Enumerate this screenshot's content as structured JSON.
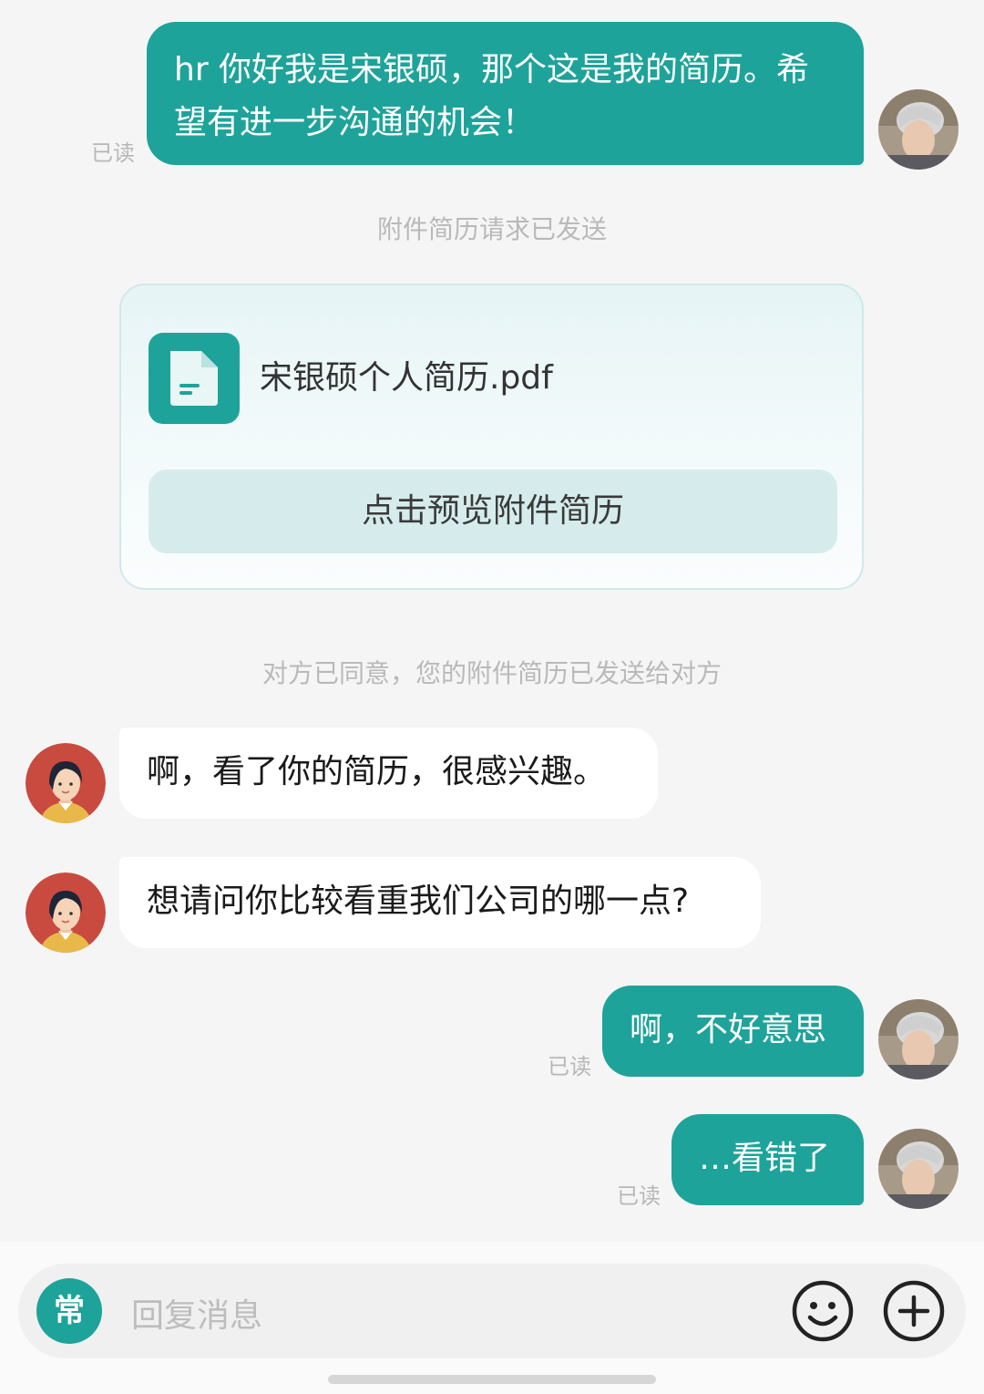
{
  "messages": {
    "m1": {
      "text": "hr 你好我是宋银硕，那个这是我的简历。希望有进一步沟通的机会！",
      "status": "已读"
    },
    "m4": {
      "text": "啊，不好意思",
      "status": "已读"
    },
    "m5": {
      "text": "…看错了",
      "status": "已读"
    },
    "hr1": {
      "text": "啊，看了你的简历，很感兴趣。"
    },
    "hr2": {
      "text": "想请问你比较看重我们公司的哪一点?"
    }
  },
  "system": {
    "request_sent": "附件简历请求已发送",
    "agreed": "对方已同意，您的附件简历已发送给对方"
  },
  "attachment": {
    "file_name": "宋银硕个人简历.pdf",
    "preview_label": "点击预览附件简历",
    "icon": "document-icon"
  },
  "input_bar": {
    "quick_phrase_label": "常",
    "placeholder": "回复消息",
    "emoji_icon": "smiley-icon",
    "plus_icon": "plus-icon"
  },
  "colors": {
    "accent": "#1ea39a",
    "background": "#f5f5f5",
    "hr_bubble": "#ffffff",
    "muted_text": "#b9b9b9"
  }
}
